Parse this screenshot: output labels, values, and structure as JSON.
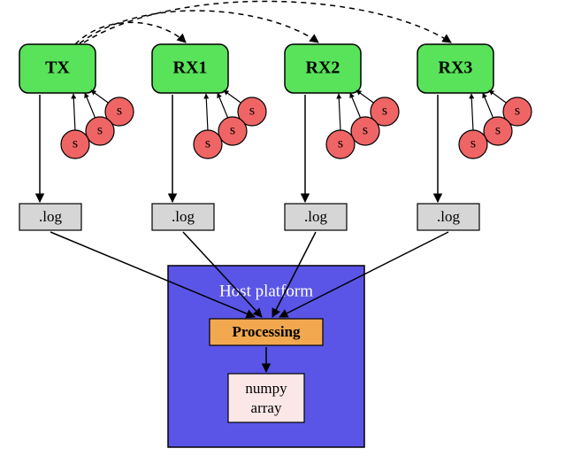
{
  "nodes": {
    "tx": {
      "label": "TX",
      "color": "#59e35a"
    },
    "rx1": {
      "label": "RX1",
      "color": "#59e35a"
    },
    "rx2": {
      "label": "RX2",
      "color": "#59e35a"
    },
    "rx3": {
      "label": "RX3",
      "color": "#59e35a"
    }
  },
  "sensor": {
    "label": "s",
    "color": "#ef6565"
  },
  "log": {
    "label": ".log",
    "color": "#d6d6d6"
  },
  "host": {
    "title": "Host platform",
    "color": "#5a55e6",
    "processing_label": "Processing",
    "processing_color": "#f2a84f",
    "numpy_label_line1": "numpy",
    "numpy_label_line2": "array",
    "numpy_color": "#fce7e7"
  }
}
